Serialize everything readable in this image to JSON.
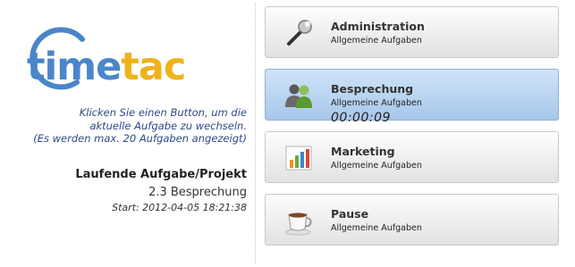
{
  "logo": {
    "part1": "time",
    "part2": "tac"
  },
  "hint": {
    "line1": "Klicken Sie einen Button, um die",
    "line2": "aktuelle Aufgabe zu wechseln.",
    "line3": "(Es werden max. 20 Aufgaben angezeigt)"
  },
  "current": {
    "title": "Laufende Aufgabe/Projekt",
    "task": "2.3 Besprechung",
    "start": "Start: 2012-04-05 18:21:38"
  },
  "tasks": [
    {
      "name": "Administration",
      "subtitle": "Allgemeine Aufgaben",
      "icon": "wrench-icon",
      "active": false
    },
    {
      "name": "Besprechung",
      "subtitle": "Allgemeine Aufgaben",
      "icon": "meeting-people-icon",
      "active": true,
      "timer": "00:00:09"
    },
    {
      "name": "Marketing",
      "subtitle": "Allgemeine Aufgaben",
      "icon": "bar-chart-icon",
      "active": false
    },
    {
      "name": "Pause",
      "subtitle": "Allgemeine Aufgaben",
      "icon": "coffee-cup-icon",
      "active": false
    }
  ],
  "colors": {
    "brand_blue": "#4a86c8",
    "brand_yellow": "#f0b21c",
    "hint_text": "#2f4a87",
    "active_task": "#b9d4f1"
  }
}
